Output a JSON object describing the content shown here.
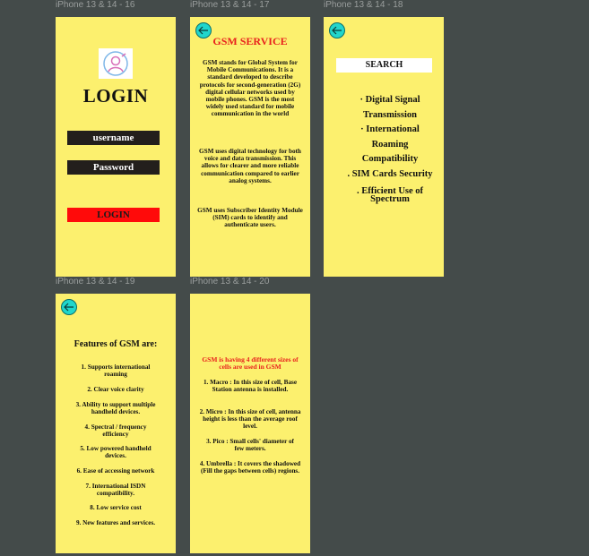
{
  "frames": {
    "f16": {
      "label": "iPhone 13 & 14 - 16"
    },
    "f17": {
      "label": "iPhone 13 & 14 - 17"
    },
    "f18": {
      "label": "iPhone 13 & 14 - 18"
    },
    "f19": {
      "label": "iPhone 13 & 14 - 19"
    },
    "f20": {
      "label": "iPhone 13 & 14 - 20"
    }
  },
  "login": {
    "title": "LOGIN",
    "username": "username",
    "password": "Password",
    "button": "LOGIN",
    "button_color": "#ff0a0a"
  },
  "service": {
    "title": "GSM SERVICE",
    "p1": "GSM stands for Global System for Mobile Communications. It is a standard developed to describe protocols for second-generation (2G) digital cellular networks used by mobile phones. GSM is the most widely used standard for mobile communication in the world",
    "p2": "GSM uses digital technology for both voice and data transmission. This allows for clearer and more reliable communication compared to earlier analog systems.",
    "p3": "GSM uses Subscriber Identity Module (SIM) cards to identify and authenticate users."
  },
  "search": {
    "label": "SEARCH",
    "items": [
      "· Digital Signal Transmission",
      "· International Roaming Compatibility",
      ". SIM Cards Security",
      ". Efficient Use of Spectrum"
    ]
  },
  "features": {
    "title": "Features of GSM are:",
    "items": [
      "1. Supports international roaming",
      "2. Clear voice clarity",
      "3. Ability to support multiple handheld devices.",
      "4. Spectral / frequency efficiency",
      "5. Low powered handheld devices.",
      "6. Ease of accessing network",
      "7. International ISDN compatibility.",
      "8. Low service cost",
      "9. New features and services."
    ]
  },
  "cells": {
    "heading": "GSM is having 4 different sizes of cells are used in GSM",
    "items": [
      "1. Macro : In this size of cell, Base Station antenna is installed.",
      "2. Micro : In this size of cell, antenna height is less than the average roof level.",
      "3. Pico : Small cells' diameter of few meters.",
      "4. Umbrella : It covers the shadowed (Fill the gaps between cells) regions."
    ]
  },
  "colors": {
    "canvas": "#444b4a",
    "frame": "#fcf06e",
    "accent_red": "#e8211d",
    "back_button": "#21d6cc"
  },
  "icons": {
    "avatar": "user-avatar-icon",
    "back": "arrow-left-icon"
  }
}
